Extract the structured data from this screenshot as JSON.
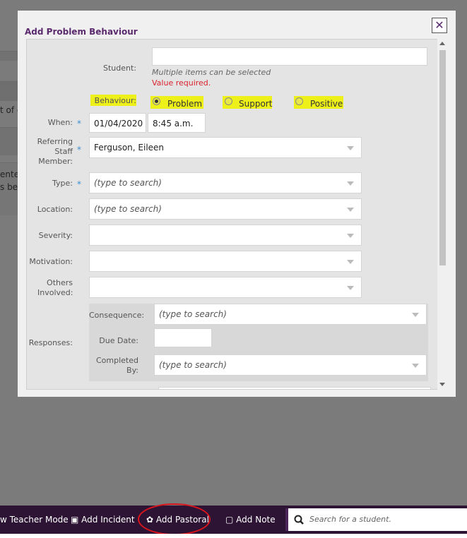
{
  "background": {
    "text_fragments": [
      "t of e",
      "ente",
      "s bee"
    ]
  },
  "modal": {
    "title": "Add Problem Behaviour",
    "close_icon": "close-x-icon",
    "student": {
      "label": "Student:",
      "value": "",
      "hint": "Multiple items can be selected",
      "error": "Value required."
    },
    "behaviour": {
      "label": "Behaviour:",
      "options": [
        "Problem",
        "Support",
        "Positive"
      ],
      "selected": "Problem"
    },
    "when": {
      "label": "When:",
      "date": "01/04/2020",
      "time": "8:45 a.m."
    },
    "referring": {
      "label": "Referring Staff Member:",
      "value": "Ferguson, Eileen"
    },
    "type": {
      "label": "Type:",
      "placeholder": "(type to search)"
    },
    "location": {
      "label": "Location:",
      "placeholder": "(type to search)"
    },
    "severity": {
      "label": "Severity:",
      "value": ""
    },
    "motivation": {
      "label": "Motivation:",
      "value": ""
    },
    "others": {
      "label": "Others Involved:",
      "value": ""
    },
    "responses": {
      "label": "Responses:",
      "consequence_label": "Consequence:",
      "consequence_placeholder": "(type to search)",
      "due_label": "Due Date:",
      "due_value": "",
      "completed_label": "Completed By:",
      "completed_placeholder": "(type to search)"
    },
    "required_mark": "*",
    "highlight_color": "#eef01a"
  },
  "bottom_bar": {
    "items": [
      "w Teacher Mode",
      "Add Incident",
      "Add Pastoral",
      "Add Note"
    ],
    "search_placeholder": "Search for a student.",
    "annotation_color": "#d9141b"
  }
}
